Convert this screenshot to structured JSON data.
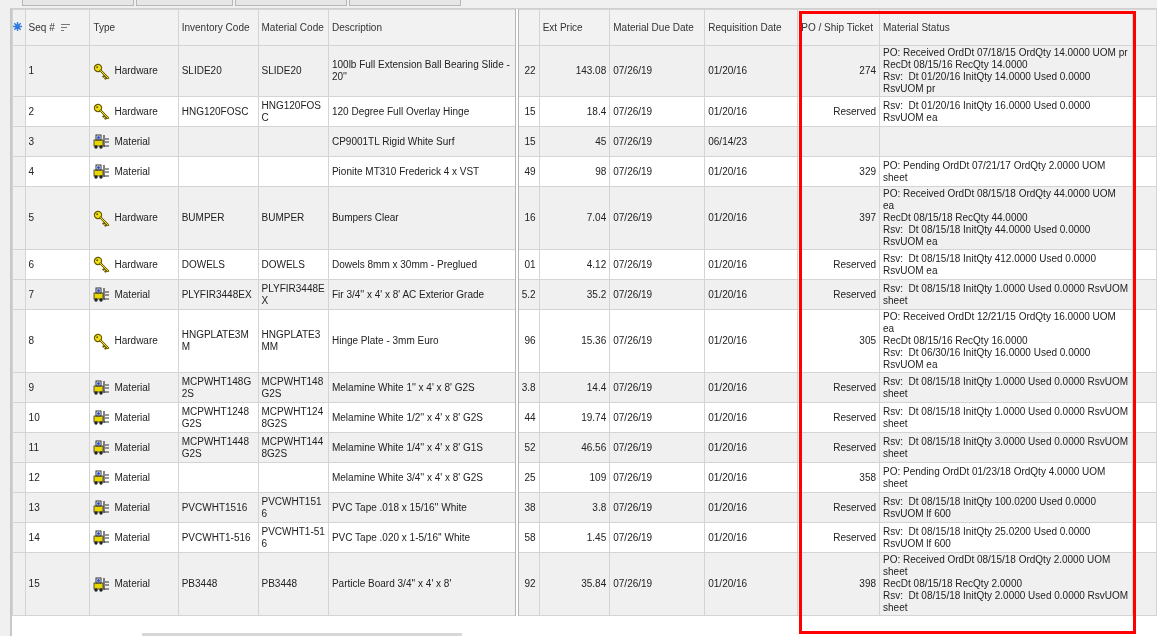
{
  "table": {
    "columns": [
      {
        "label": "Seq #",
        "sorted": true,
        "highlighted": false
      },
      {
        "label": "Type",
        "sorted": false,
        "highlighted": false
      },
      {
        "label": "Inventory Code",
        "sorted": false,
        "highlighted": false
      },
      {
        "label": "Material Code",
        "sorted": false,
        "highlighted": false
      },
      {
        "label": "Description",
        "sorted": false,
        "highlighted": false
      },
      {
        "sorted": false,
        "highlighted": false
      },
      {
        "label": "Ext Price",
        "sorted": false,
        "highlighted": false
      },
      {
        "label": "Material Due Date",
        "sorted": false,
        "highlighted": false
      },
      {
        "label": "Requisition Date",
        "sorted": false,
        "highlighted": false
      },
      {
        "label": "PO / Ship Ticket",
        "sorted": false,
        "highlighted": true
      },
      {
        "label": "Material Status",
        "sorted": false,
        "highlighted": true
      }
    ],
    "rows": [
      {
        "seq": "1",
        "kind": "hardware",
        "type": "Hardware",
        "inventory_code": "SLIDE20",
        "material_code": "SLIDE20",
        "description": "100lb Full Extension Ball Bearing Slide - 20''",
        "column_6": "22",
        "ext_price": "143.08",
        "material_due_date": "07/26/19",
        "requisition_date": "01/20/16",
        "po_ship_ticket": "274",
        "material_status": [
          "PO: Received OrdDt 07/18/15 OrdQty 14.0000 UOM pr",
          "RecDt 08/15/16 RecQty 14.0000",
          "Rsv:  Dt 01/20/16 InitQty 14.0000 Used 0.0000 RsvUOM pr"
        ]
      },
      {
        "seq": "2",
        "kind": "hardware",
        "type": "Hardware",
        "inventory_code": "HNG120FOSC",
        "material_code": "HNG120FOSC",
        "description": "120 Degree Full Overlay Hinge",
        "column_6": "15",
        "ext_price": "18.4",
        "material_due_date": "07/26/19",
        "requisition_date": "01/20/16",
        "po_ship_ticket": "Reserved",
        "material_status": [
          "Rsv:  Dt 01/20/16 InitQty 16.0000 Used 0.0000 RsvUOM ea"
        ]
      },
      {
        "seq": "3",
        "kind": "material",
        "type": "Material",
        "description": "CP9001TL Rigid White Surf",
        "column_6": "15",
        "ext_price": "45",
        "material_due_date": "07/26/19",
        "requisition_date": "06/14/23"
      },
      {
        "seq": "4",
        "kind": "material",
        "type": "Material",
        "description": "Pionite MT310 Frederick 4 x VST",
        "column_6": "49",
        "ext_price": "98",
        "material_due_date": "07/26/19",
        "requisition_date": "01/20/16",
        "po_ship_ticket": "329",
        "material_status": [
          "PO: Pending OrdDt 07/21/17 OrdQty 2.0000 UOM sheet"
        ]
      },
      {
        "seq": "5",
        "kind": "hardware",
        "type": "Hardware",
        "inventory_code": "BUMPER",
        "material_code": "BUMPER",
        "description": "Bumpers Clear",
        "column_6": "16",
        "ext_price": "7.04",
        "material_due_date": "07/26/19",
        "requisition_date": "01/20/16",
        "po_ship_ticket": "397",
        "material_status": [
          "PO: Received OrdDt 08/15/18 OrdQty 44.0000 UOM ea",
          "RecDt 08/15/18 RecQty 44.0000",
          "Rsv:  Dt 08/15/18 InitQty 44.0000 Used 0.0000 RsvUOM ea"
        ]
      },
      {
        "seq": "6",
        "kind": "hardware",
        "type": "Hardware",
        "inventory_code": "DOWELS",
        "material_code": "DOWELS",
        "description": "Dowels 8mm x 30mm - Preglued",
        "column_6": "01",
        "ext_price": "4.12",
        "material_due_date": "07/26/19",
        "requisition_date": "01/20/16",
        "po_ship_ticket": "Reserved",
        "material_status": [
          "Rsv:  Dt 08/15/18 InitQty 412.0000 Used 0.0000 RsvUOM ea"
        ]
      },
      {
        "seq": "7",
        "kind": "material",
        "type": "Material",
        "inventory_code": "PLYFIR3448EX",
        "material_code": "PLYFIR3448EX",
        "description": "Fir 3/4'' x 4' x 8' AC Exterior Grade",
        "column_6": "5.2",
        "ext_price": "35.2",
        "material_due_date": "07/26/19",
        "requisition_date": "01/20/16",
        "po_ship_ticket": "Reserved",
        "material_status": [
          "Rsv:  Dt 08/15/18 InitQty 1.0000 Used 0.0000 RsvUOM sheet"
        ]
      },
      {
        "seq": "8",
        "kind": "hardware",
        "type": "Hardware",
        "inventory_code": "HNGPLATE3MM",
        "material_code": "HNGPLATE3MM",
        "description": "Hinge Plate - 3mm Euro",
        "column_6": "96",
        "ext_price": "15.36",
        "material_due_date": "07/26/19",
        "requisition_date": "01/20/16",
        "po_ship_ticket": "305",
        "material_status": [
          "PO: Received OrdDt 12/21/15 OrdQty 16.0000 UOM ea",
          "RecDt 08/15/16 RecQty 16.0000",
          "Rsv:  Dt 06/30/16 InitQty 16.0000 Used 0.0000 RsvUOM ea"
        ]
      },
      {
        "seq": "9",
        "kind": "material",
        "type": "Material",
        "inventory_code": "MCPWHT148G2S",
        "material_code": "MCPWHT148G2S",
        "description": "Melamine White 1'' x 4' x 8' G2S",
        "column_6": "3.8",
        "ext_price": "14.4",
        "material_due_date": "07/26/19",
        "requisition_date": "01/20/16",
        "po_ship_ticket": "Reserved",
        "material_status": [
          "Rsv:  Dt 08/15/18 InitQty 1.0000 Used 0.0000 RsvUOM sheet"
        ]
      },
      {
        "seq": "10",
        "kind": "material",
        "type": "Material",
        "inventory_code": "MCPWHT1248G2S",
        "material_code": "MCPWHT1248G2S",
        "description": "Melamine White 1/2'' x 4' x 8' G2S",
        "column_6": "44",
        "ext_price": "19.74",
        "material_due_date": "07/26/19",
        "requisition_date": "01/20/16",
        "po_ship_ticket": "Reserved",
        "material_status": [
          "Rsv:  Dt 08/15/18 InitQty 1.0000 Used 0.0000 RsvUOM sheet"
        ]
      },
      {
        "seq": "11",
        "kind": "material",
        "type": "Material",
        "inventory_code": "MCPWHT1448G2S",
        "material_code": "MCPWHT1448G2S",
        "description": "Melamine White 1/4'' x 4' x 8' G1S",
        "column_6": "52",
        "ext_price": "46.56",
        "material_due_date": "07/26/19",
        "requisition_date": "01/20/16",
        "po_ship_ticket": "Reserved",
        "material_status": [
          "Rsv:  Dt 08/15/18 InitQty 3.0000 Used 0.0000 RsvUOM sheet"
        ]
      },
      {
        "seq": "12",
        "kind": "material",
        "type": "Material",
        "description": "Melamine White 3/4'' x 4' x 8' G2S",
        "column_6": "25",
        "ext_price": "109",
        "material_due_date": "07/26/19",
        "requisition_date": "01/20/16",
        "po_ship_ticket": "358",
        "material_status": [
          "PO: Pending OrdDt 01/23/18 OrdQty 4.0000 UOM sheet"
        ]
      },
      {
        "seq": "13",
        "kind": "material",
        "type": "Material",
        "inventory_code": "PVCWHT1516",
        "material_code": "PVCWHT1516",
        "description": "PVC Tape .018 x 15/16'' White",
        "column_6": "38",
        "ext_price": "3.8",
        "material_due_date": "07/26/19",
        "requisition_date": "01/20/16",
        "po_ship_ticket": "Reserved",
        "material_status": [
          "Rsv:  Dt 08/15/18 InitQty 100.0200 Used 0.0000 RsvUOM lf 600"
        ]
      },
      {
        "seq": "14",
        "kind": "material",
        "type": "Material",
        "inventory_code": "PVCWHT1-516",
        "material_code": "PVCWHT1-516",
        "description": "PVC Tape .020 x 1-5/16'' White",
        "column_6": "58",
        "ext_price": "1.45",
        "material_due_date": "07/26/19",
        "requisition_date": "01/20/16",
        "po_ship_ticket": "Reserved",
        "material_status": [
          "Rsv:  Dt 08/15/18 InitQty 25.0200 Used 0.0000 RsvUOM lf 600"
        ]
      },
      {
        "seq": "15",
        "kind": "material",
        "type": "Material",
        "inventory_code": "PB3448",
        "material_code": "PB3448",
        "description": "Particle Board 3/4'' x 4' x 8'",
        "column_6": "92",
        "ext_price": "35.84",
        "material_due_date": "07/26/19",
        "requisition_date": "01/20/16",
        "po_ship_ticket": "398",
        "material_status": [
          "PO: Received OrdDt 08/15/18 OrdQty 2.0000 UOM sheet",
          "RecDt 08/15/18 RecQty 2.0000",
          "Rsv:  Dt 08/15/18 InitQty 2.0000 Used 0.0000 RsvUOM sheet"
        ]
      }
    ]
  }
}
